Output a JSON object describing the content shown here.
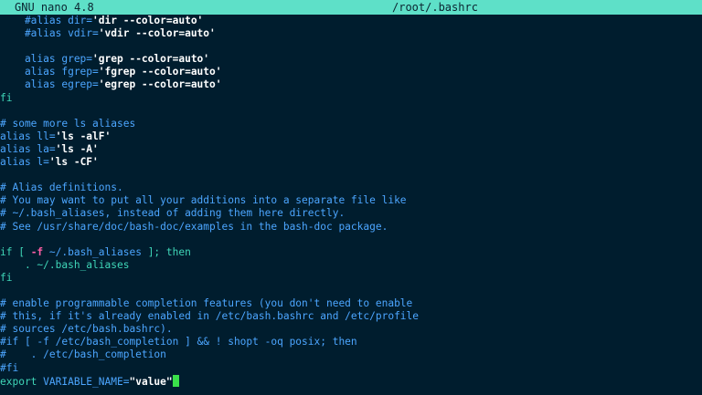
{
  "titlebar": {
    "app_name": "GNU nano 4.8",
    "file_path": "/root/.bashrc"
  },
  "colors": {
    "background": "#001d2e",
    "titlebar": "#5ee0c8",
    "comment": "#4ca6ff",
    "keyword": "#3fd6b8",
    "string": "#ffffff",
    "flag": "#ff5fa6",
    "cursor": "#3ae04a"
  },
  "editor": {
    "lines": [
      [
        {
          "t": "    #alias dir=",
          "k": "comment"
        },
        {
          "t": "'dir --color=auto'",
          "k": "string"
        }
      ],
      [
        {
          "t": "    #alias vdir=",
          "k": "comment"
        },
        {
          "t": "'vdir --color=auto'",
          "k": "string"
        }
      ],
      [],
      [
        {
          "t": "    alias grep=",
          "k": "word"
        },
        {
          "t": "'grep --color=auto'",
          "k": "string"
        }
      ],
      [
        {
          "t": "    alias fgrep=",
          "k": "word"
        },
        {
          "t": "'fgrep --color=auto'",
          "k": "string"
        }
      ],
      [
        {
          "t": "    alias egrep=",
          "k": "word"
        },
        {
          "t": "'egrep --color=auto'",
          "k": "string"
        }
      ],
      [
        {
          "t": "fi",
          "k": "keyword"
        }
      ],
      [],
      [
        {
          "t": "# some more ls aliases",
          "k": "comment"
        }
      ],
      [
        {
          "t": "alias ll=",
          "k": "word"
        },
        {
          "t": "'ls -alF'",
          "k": "string"
        }
      ],
      [
        {
          "t": "alias la=",
          "k": "word"
        },
        {
          "t": "'ls -A'",
          "k": "string"
        }
      ],
      [
        {
          "t": "alias l=",
          "k": "word"
        },
        {
          "t": "'ls -CF'",
          "k": "string"
        }
      ],
      [],
      [
        {
          "t": "# Alias definitions.",
          "k": "comment"
        }
      ],
      [
        {
          "t": "# You may want to put all your additions into a separate file like",
          "k": "comment"
        }
      ],
      [
        {
          "t": "# ~/.bash_aliases, instead of adding them here directly.",
          "k": "comment"
        }
      ],
      [
        {
          "t": "# See /usr/share/doc/bash-doc/examples in the bash-doc package.",
          "k": "comment"
        }
      ],
      [],
      [
        {
          "t": "if [ ",
          "k": "keyword"
        },
        {
          "t": "-f",
          "k": "flag"
        },
        {
          "t": " ~/.bash_aliases ",
          "k": "word"
        },
        {
          "t": "]; then",
          "k": "keyword"
        }
      ],
      [
        {
          "t": "    . ~/.bash_aliases",
          "k": "keyword"
        }
      ],
      [
        {
          "t": "fi",
          "k": "keyword"
        }
      ],
      [],
      [
        {
          "t": "# enable programmable completion features (you don't need to enable",
          "k": "comment"
        }
      ],
      [
        {
          "t": "# this, if it's already enabled in /etc/bash.bashrc and /etc/profile",
          "k": "comment"
        }
      ],
      [
        {
          "t": "# sources /etc/bash.bashrc).",
          "k": "comment"
        }
      ],
      [
        {
          "t": "#if [ -f /etc/bash_completion ] && ! shopt -oq posix; then",
          "k": "comment"
        }
      ],
      [
        {
          "t": "#    . /etc/bash_completion",
          "k": "comment"
        }
      ],
      [
        {
          "t": "#fi",
          "k": "comment"
        }
      ],
      [
        {
          "t": "export",
          "k": "keyword"
        },
        {
          "t": " VARIABLE_NAME=",
          "k": "word"
        },
        {
          "t": "\"value\"",
          "k": "string"
        }
      ]
    ]
  }
}
